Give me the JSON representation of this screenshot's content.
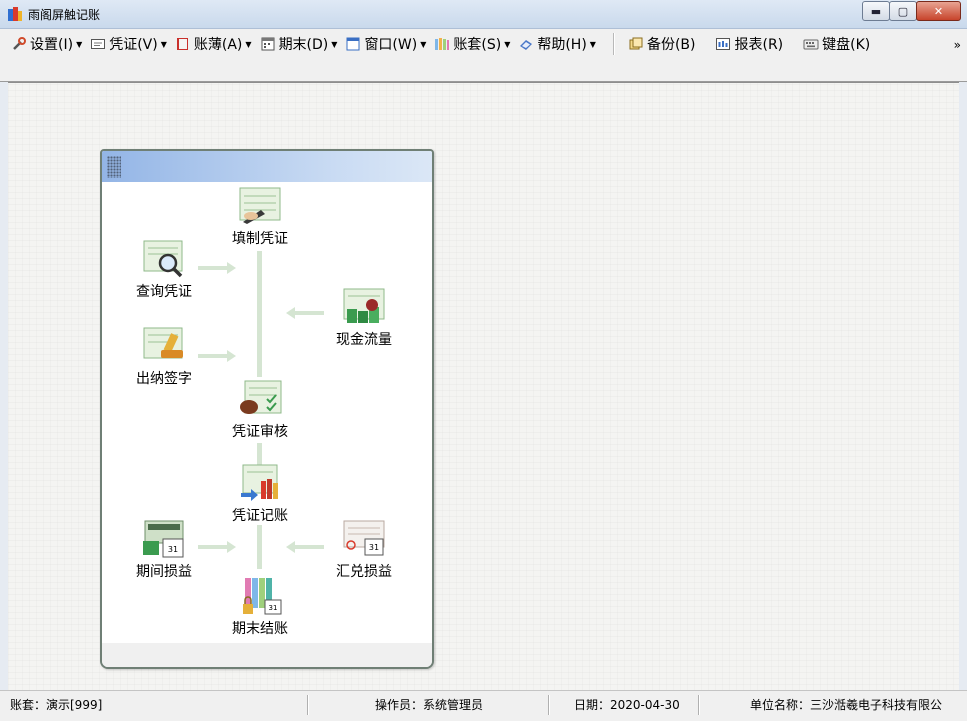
{
  "window": {
    "title": "雨阁屏触记账",
    "min_label": "▬",
    "max_label": "▢",
    "close_label": "✕"
  },
  "toolbar": {
    "items": [
      {
        "label": "设置(I)",
        "icon": "wrench-icon",
        "dropdown": true
      },
      {
        "label": "凭证(V)",
        "icon": "voucher-icon",
        "dropdown": true
      },
      {
        "label": "账薄(A)",
        "icon": "ledger-book-icon",
        "dropdown": true
      },
      {
        "label": "期末(D)",
        "icon": "calendar-icon",
        "dropdown": true
      },
      {
        "label": "窗口(W)",
        "icon": "window-icon",
        "dropdown": true
      },
      {
        "label": "账套(S)",
        "icon": "account-set-icon",
        "dropdown": true
      },
      {
        "label": "帮助(H)",
        "icon": "help-book-icon",
        "dropdown": true
      },
      {
        "label": "备份(B)",
        "icon": "backup-icon",
        "dropdown": false
      },
      {
        "label": "报表(R)",
        "icon": "report-icon",
        "dropdown": false
      },
      {
        "label": "键盘(K)",
        "icon": "keyboard-icon",
        "dropdown": false
      }
    ],
    "overflow_label": "»"
  },
  "flow": {
    "nodes": {
      "fill_voucher": "填制凭证",
      "query_voucher": "查询凭证",
      "cash_flow": "现金流量",
      "cashier_sign": "出纳签字",
      "voucher_audit": "凭证审核",
      "voucher_post": "凭证记账",
      "period_pl": "期间损益",
      "fx_pl": "汇兑损益",
      "period_close": "期末结账"
    },
    "calendar_day": "31"
  },
  "status": {
    "account_set": "账套：演示[999]",
    "operator": "操作员：系统管理员",
    "date": "日期：2020-04-30",
    "company": "单位名称：三沙湉羲电子科技有限公"
  }
}
